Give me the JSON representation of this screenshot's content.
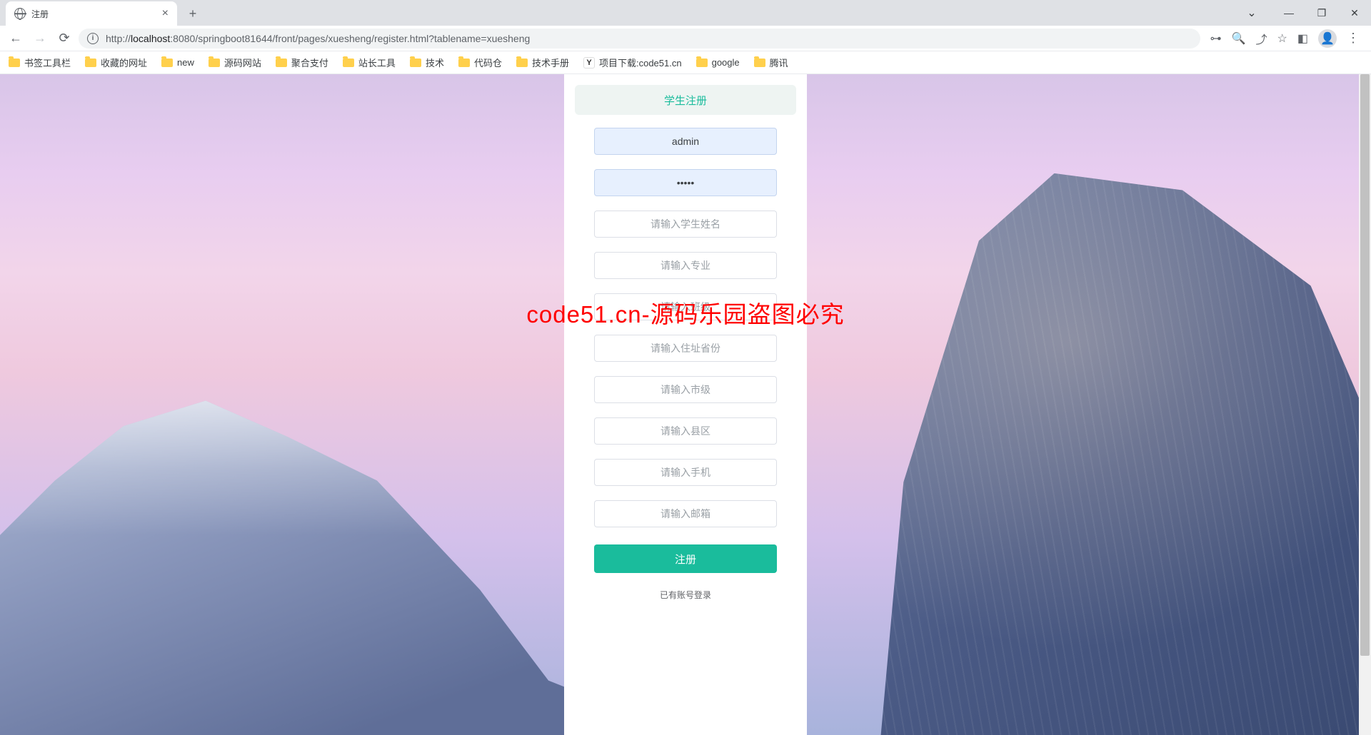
{
  "browser": {
    "tab_title": "注册",
    "url_host": "localhost",
    "url_port": ":8080",
    "url_path": "/springboot81644/front/pages/xuesheng/register.html?tablename=xuesheng",
    "url_prefix": "http://"
  },
  "bookmarks": [
    {
      "label": "书签工具栏",
      "icon": "folder"
    },
    {
      "label": "收藏的网址",
      "icon": "folder"
    },
    {
      "label": "new",
      "icon": "folder"
    },
    {
      "label": "源码网站",
      "icon": "folder"
    },
    {
      "label": "聚合支付",
      "icon": "folder"
    },
    {
      "label": "站长工具",
      "icon": "folder"
    },
    {
      "label": "技术",
      "icon": "folder"
    },
    {
      "label": "代码仓",
      "icon": "folder"
    },
    {
      "label": "技术手册",
      "icon": "folder"
    },
    {
      "label": "项目下载:code51.cn",
      "icon": "y"
    },
    {
      "label": "google",
      "icon": "folder"
    },
    {
      "label": "腾讯",
      "icon": "folder"
    }
  ],
  "form": {
    "title": "学生注册",
    "username_value": "admin",
    "password_value": "•••••",
    "placeholders": {
      "student_name": "请输入学生姓名",
      "major": "请输入专业",
      "class": "请输入班级",
      "province": "请输入住址省份",
      "city": "请输入市级",
      "district": "请输入县区",
      "phone": "请输入手机",
      "email": "请输入邮箱"
    },
    "submit_label": "注册",
    "login_link_label": "已有账号登录"
  },
  "watermark": "code51.cn-源码乐园盗图必究"
}
